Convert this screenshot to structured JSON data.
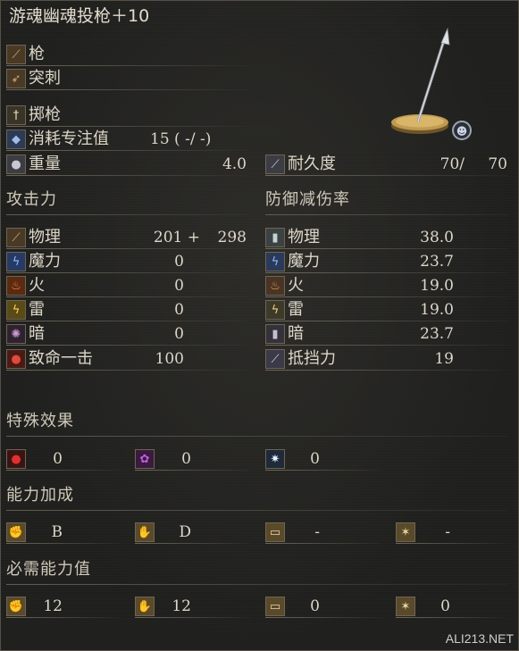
{
  "item": {
    "name": "游魂幽魂投枪＋10",
    "weapon_type": "枪",
    "attack_type": "突刺",
    "skill_name": "掷枪",
    "fp_label": "消耗专注值",
    "fp_value": "15 (   -/   -)",
    "weight_label": "重量",
    "weight_value": "4.0",
    "durability_label": "耐久度",
    "durability_current": "70/",
    "durability_max": "70"
  },
  "attack": {
    "header": "攻击力",
    "rows": [
      {
        "label": "物理",
        "value": "201 +",
        "extra": "298",
        "icon": "physical-icon"
      },
      {
        "label": "魔力",
        "value": "0",
        "icon": "magic-icon"
      },
      {
        "label": "火",
        "value": "0",
        "icon": "fire-icon"
      },
      {
        "label": "雷",
        "value": "0",
        "icon": "lightning-icon"
      },
      {
        "label": "暗",
        "value": "0",
        "icon": "dark-icon"
      },
      {
        "label": "致命一击",
        "value": "100",
        "icon": "critical-icon"
      }
    ]
  },
  "defense": {
    "header": "防御减伤率",
    "rows": [
      {
        "label": "物理",
        "value": "38.0",
        "icon": "physical-guard-icon"
      },
      {
        "label": "魔力",
        "value": "23.7",
        "icon": "magic-guard-icon"
      },
      {
        "label": "火",
        "value": "19.0",
        "icon": "fire-guard-icon"
      },
      {
        "label": "雷",
        "value": "19.0",
        "icon": "lightning-guard-icon"
      },
      {
        "label": "暗",
        "value": "23.7",
        "icon": "dark-guard-icon"
      },
      {
        "label": "抵挡力",
        "value": "19",
        "icon": "stability-icon"
      }
    ]
  },
  "effects": {
    "header": "特殊效果",
    "items": [
      {
        "icon": "bleed-icon",
        "value": "0"
      },
      {
        "icon": "poison-icon",
        "value": "0"
      },
      {
        "icon": "frost-icon",
        "value": "0"
      }
    ]
  },
  "scaling": {
    "header": "能力加成",
    "items": [
      {
        "icon": "strength-icon",
        "value": "B"
      },
      {
        "icon": "dexterity-icon",
        "value": "D"
      },
      {
        "icon": "intelligence-icon",
        "value": "-"
      },
      {
        "icon": "faith-icon",
        "value": "-"
      }
    ]
  },
  "requirements": {
    "header": "必需能力值",
    "items": [
      {
        "icon": "strength-icon",
        "value": "12"
      },
      {
        "icon": "dexterity-icon",
        "value": "12"
      },
      {
        "icon": "intelligence-icon",
        "value": "0"
      },
      {
        "icon": "faith-icon",
        "value": "0"
      }
    ]
  },
  "watermark": "ALI213.NET",
  "colors": {
    "background": "#1f1f1d",
    "text": "#ddd7c8",
    "icon_border": "#6d6554",
    "pedestal_gold": "#b8924a"
  }
}
